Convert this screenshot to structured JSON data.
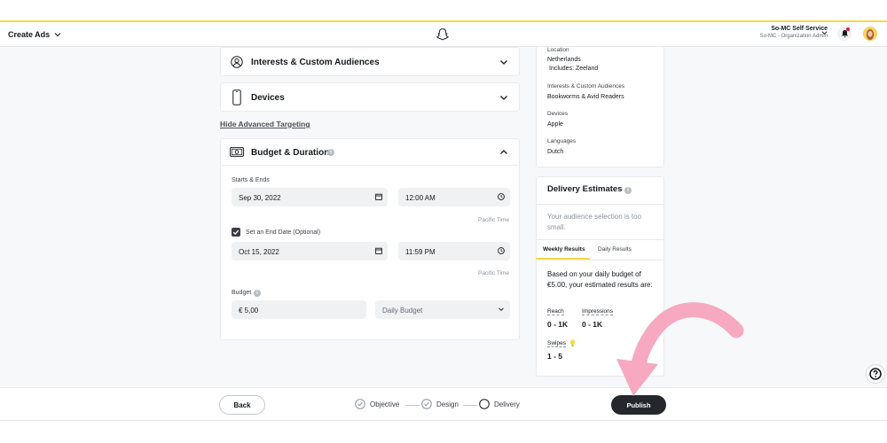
{
  "header": {
    "menu_label": "Create Ads",
    "account_name": "So-MC Self Service",
    "account_sub": "So-MC - Organization Admin"
  },
  "targeting": {
    "interests_title": "Interests & Custom Audiences",
    "devices_title": "Devices",
    "hide_advanced": "Hide Advanced Targeting"
  },
  "budget": {
    "title": "Budget & Duration",
    "starts_label": "Starts & Ends",
    "start_date": "Sep 30, 2022",
    "start_time": "12:00 AM",
    "timezone": "Pacific Time",
    "end_date_label": "Set an End Date (Optional)",
    "end_date_checked": true,
    "end_date": "Oct 15, 2022",
    "end_time": "11:59 PM",
    "budget_label": "Budget",
    "budget_value": "€ 5,00",
    "budget_type": "Daily Budget"
  },
  "summary": {
    "location_h": "Location",
    "location_v1": "Netherlands",
    "location_v2": "Includes: Zeeland",
    "interests_h": "Interests & Custom Audiences",
    "interests_v": "Bookworms & Avid Readers",
    "devices_h": "Devices",
    "devices_v": "Apple",
    "languages_h": "Languages",
    "languages_v": "Dutch"
  },
  "delivery": {
    "title": "Delivery Estimates",
    "note": "Your audience selection is too small.",
    "tab_weekly": "Weekly Results",
    "tab_daily": "Daily Results",
    "body": "Based on your daily budget of €5.00, your estimated results are:",
    "reach_h": "Reach",
    "reach_v": "0 - 1K",
    "impressions_h": "Impressions",
    "impressions_v": "0 - 1K",
    "swipes_h": "Swipes",
    "swipes_v": "1 - 5"
  },
  "footer": {
    "back": "Back",
    "step1": "Objective",
    "step2": "Design",
    "step3": "Delivery",
    "publish": "Publish"
  },
  "colors": {
    "accent_yellow": "#f7d94c",
    "dark_button": "#24272b",
    "arrow_pink": "#f6a9c1"
  }
}
